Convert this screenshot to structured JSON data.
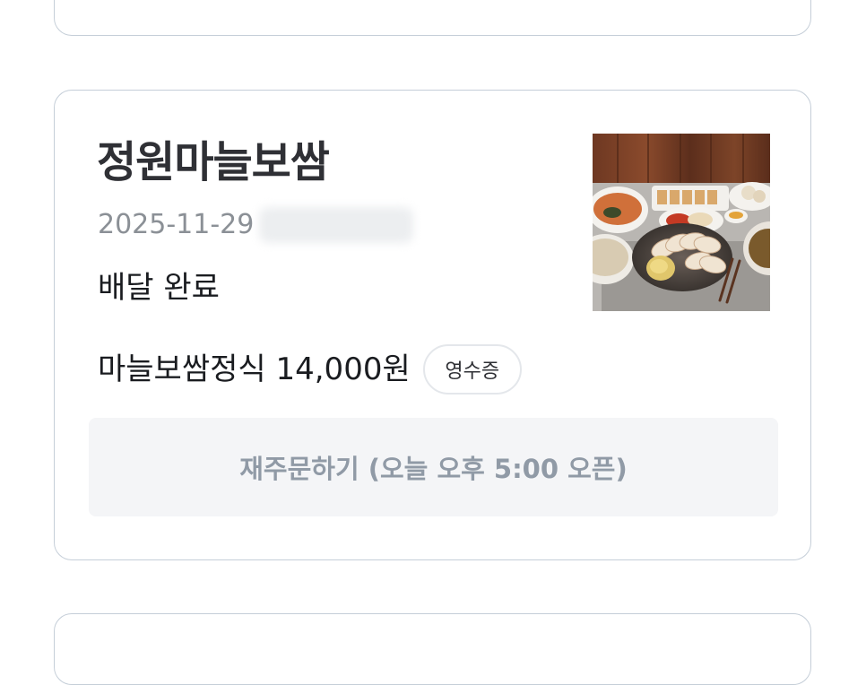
{
  "order": {
    "store_name": "정원마늘보쌈",
    "date": "2025-11-29",
    "status": "배달 완료",
    "menu_summary": "마늘보쌈정식 14,000원",
    "receipt_label": "영수증",
    "reorder_label": "재주문하기 (오늘 오후 5:00 오픈)",
    "image_icon": "food-photo-bossam-set"
  },
  "colors": {
    "card_border": "#c5ced8",
    "title_text": "#2f3035",
    "date_text": "#8b9096",
    "reorder_bg": "#f4f5f7",
    "reorder_text": "#909aa6"
  }
}
